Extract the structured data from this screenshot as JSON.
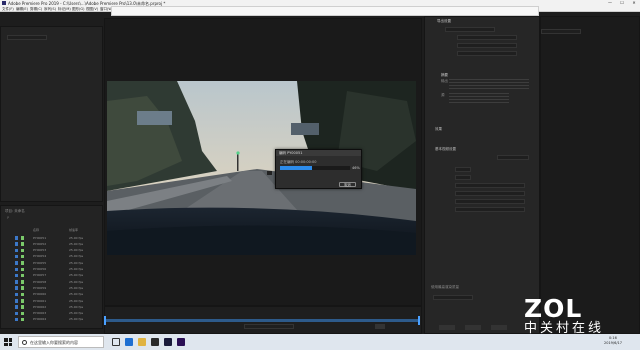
{
  "titlebar": {
    "title": "Adobe Premiere Pro 2019 - C:\\Users\\...\\Adobe Premiere Pro\\13.0\\未命名.prproj *",
    "minimize": "—",
    "maximize": "☐",
    "close": "✕"
  },
  "menu": [
    "文件(F)",
    "编辑(E)",
    "剪辑(C)",
    "序列(S)",
    "标记(M)",
    "图形(G)",
    "视图(V)",
    "窗口(W)",
    "帮助(H)"
  ],
  "dialog": {
    "title": "编码 PY00051",
    "message": "正在编码 00:00:00:00",
    "percent": "46%",
    "progress": 0.46,
    "cancel": "取消"
  },
  "project_panel": {
    "tab": "项目: 未命名",
    "search": "Ρ",
    "header_name": "名称",
    "header_rate": "帧速率",
    "rows": [
      {
        "name": "PY00051",
        "rate": "25.00 fps"
      },
      {
        "name": "PY00052",
        "rate": "25.00 fps"
      },
      {
        "name": "PY00053",
        "rate": "25.00 fps"
      },
      {
        "name": "PY00054",
        "rate": "25.00 fps"
      },
      {
        "name": "PY00055",
        "rate": "25.00 fps"
      },
      {
        "name": "PY00056",
        "rate": "25.00 fps"
      },
      {
        "name": "PY00057",
        "rate": "25.00 fps"
      },
      {
        "name": "PY00058",
        "rate": "25.00 fps"
      },
      {
        "name": "PY00059",
        "rate": "25.00 fps"
      },
      {
        "name": "PY00060",
        "rate": "25.00 fps"
      },
      {
        "name": "PY00061",
        "rate": "25.00 fps"
      },
      {
        "name": "PY00062",
        "rate": "25.00 fps"
      },
      {
        "name": "PY00063",
        "rate": "25.00 fps"
      },
      {
        "name": "PY00064",
        "rate": "25.00 fps"
      }
    ]
  },
  "export_panel": {
    "section_export": "导出设置",
    "summary_label": "摘要",
    "output_label": "输出",
    "source_label": "源",
    "section_effects": "效果",
    "section_basic_video": "基本视频设置",
    "use_max_render": "使用最高渲染质量"
  },
  "taskbar": {
    "search_placeholder": "在这里输入你要搜索的内容",
    "time": "0:16",
    "date": "2019/6/17"
  },
  "watermark": {
    "logo": "ZOL",
    "subtitle": "中关村在线"
  },
  "colors": {
    "accent": "#2d8ceb",
    "panel_bg": "#232323",
    "app_bg": "#1d1d1d"
  }
}
